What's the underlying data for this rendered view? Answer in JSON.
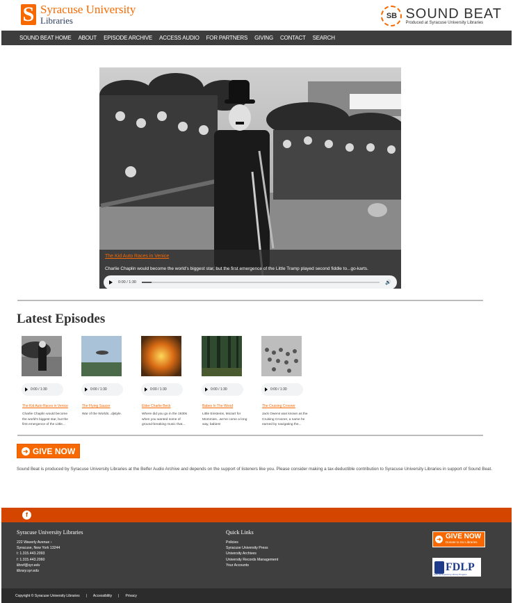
{
  "header": {
    "su_logo_letter": "S",
    "su_logo_line1": "Syracuse University",
    "su_logo_line2": "Libraries",
    "sb_badge": "SB",
    "sb_title": "SOUND BEAT",
    "sb_subtitle": "Produced at Syracuse University Libraries"
  },
  "nav": [
    "SOUND BEAT HOME",
    "ABOUT",
    "EPISODE ARCHIVE",
    "ACCESS AUDIO",
    "FOR PARTNERS",
    "GIVING",
    "CONTACT",
    "SEARCH"
  ],
  "hero": {
    "link": "The Kid Auto Races in Venice",
    "description": "Charlie Chaplin would become the world's biggest star, but the first emergence of the Little Tramp played second fiddle to...go-karts.",
    "audio_time": "0:00 / 1:30",
    "progress": 0.04
  },
  "latest": {
    "title": "Latest Episodes",
    "episodes": [
      {
        "title": "The Kid Auto Races in Venice",
        "time": "0:00 / 1:30",
        "desc": "Charlie Chaplin would become the world's biggest star, but the first emergence of the Little..."
      },
      {
        "title": "The Flying Saucer",
        "time": "0:00 / 1:30",
        "desc": "War of the Worlds...djstyle."
      },
      {
        "title": "Elder Charlie Beck",
        "time": "0:00 / 1:30",
        "desc": "Where did you go in the 1930s when you wanted some of ground-breaking music that..."
      },
      {
        "title": "Babes In The Wood",
        "time": "0:00 / 1:30",
        "desc": "Little Einsteins, Mozart for Mommies...we've come a long way, babies!"
      },
      {
        "title": "The Cruising Crooner",
        "time": "0:00 / 1:30",
        "desc": "Jack Owens was known as the Cruising Crooner, a name he earned by navigating the..."
      }
    ]
  },
  "give": {
    "label": "GIVE NOW",
    "support_text": "Sound Beat is produced by Syracuse University Libraries at the Belfer Audio Archive and depends on the support of listeners like you. Please consider making a tax-deductible contribution to Syracuse University Libraries in support of Sound Beat."
  },
  "footer": {
    "facebook_letter": "f",
    "col1_heading": "Syracuse University Libraries",
    "col1_lines": [
      "222 Waverly Avenue ›",
      "Syracuse, New York 13244",
      "t: 1.315.443.2093",
      "f: 1.315.443.2060",
      "libref@syr.edu",
      "library.syr.edu"
    ],
    "col2_heading": "Quick Links",
    "col2_links": [
      "Policies",
      "Syracuse University Press",
      "University Archives",
      "University Records Management",
      "Your Accounts"
    ],
    "give_big": "GIVE NOW",
    "give_small": "Donate to SU Libraries",
    "fdlp": "FDLP",
    "fdlp_sub": "Federal Depository Library Program",
    "copyright": "Copyright © Syracuse University Libraries",
    "accessibility": "Accessibility",
    "privacy": "Privacy",
    "separator": "|"
  }
}
